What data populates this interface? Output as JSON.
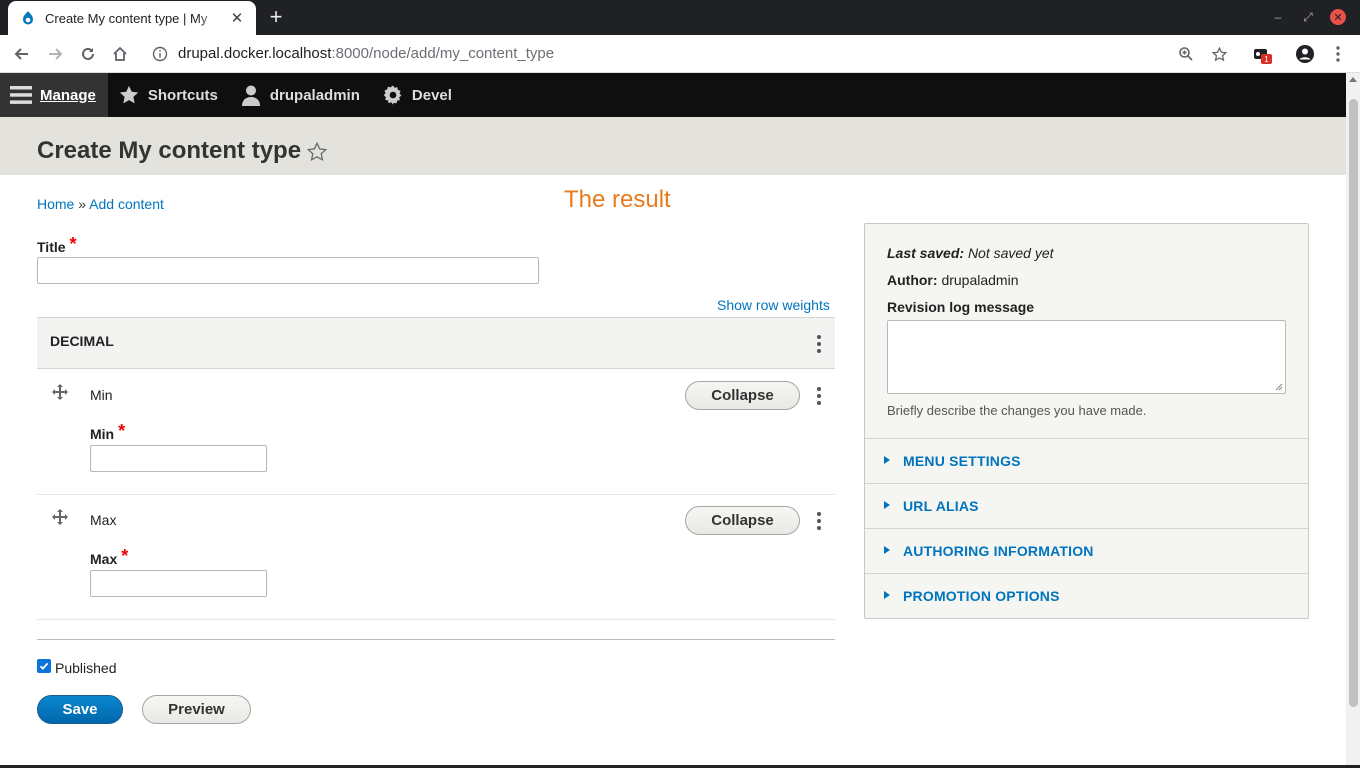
{
  "browser": {
    "tab_title": "Create My content type | My",
    "url_host": "drupal.docker.localhost",
    "url_rest": ":8000/node/add/my_content_type",
    "extension_badge": "1"
  },
  "adminbar": {
    "manage": "Manage",
    "shortcuts": "Shortcuts",
    "user": "drupaladmin",
    "devel": "Devel"
  },
  "page": {
    "title": "Create My content type",
    "breadcrumb_home": "Home",
    "breadcrumb_sep": "»",
    "breadcrumb_add": "Add content",
    "result_note": "The result"
  },
  "form": {
    "title_label": "Title",
    "required_mark": "*",
    "show_row_weights": "Show row weights",
    "table_header": "DECIMAL",
    "rows": [
      {
        "name": "Min",
        "field_label": "Min",
        "button": "Collapse"
      },
      {
        "name": "Max",
        "field_label": "Max",
        "button": "Collapse"
      }
    ],
    "published_label": "Published",
    "published_checked": true,
    "save": "Save",
    "preview": "Preview"
  },
  "sidebar": {
    "last_saved_label": "Last saved:",
    "last_saved_value": "Not saved yet",
    "author_label": "Author:",
    "author_value": "drupaladmin",
    "revision_label": "Revision log message",
    "revision_desc": "Briefly describe the changes you have made.",
    "sections": [
      "MENU SETTINGS",
      "URL ALIAS",
      "AUTHORING INFORMATION",
      "PROMOTION OPTIONS"
    ]
  },
  "colors": {
    "link": "#0074bd",
    "required": "#e00000",
    "result_note": "#e87b1c",
    "primary_button": "#0067ab"
  }
}
